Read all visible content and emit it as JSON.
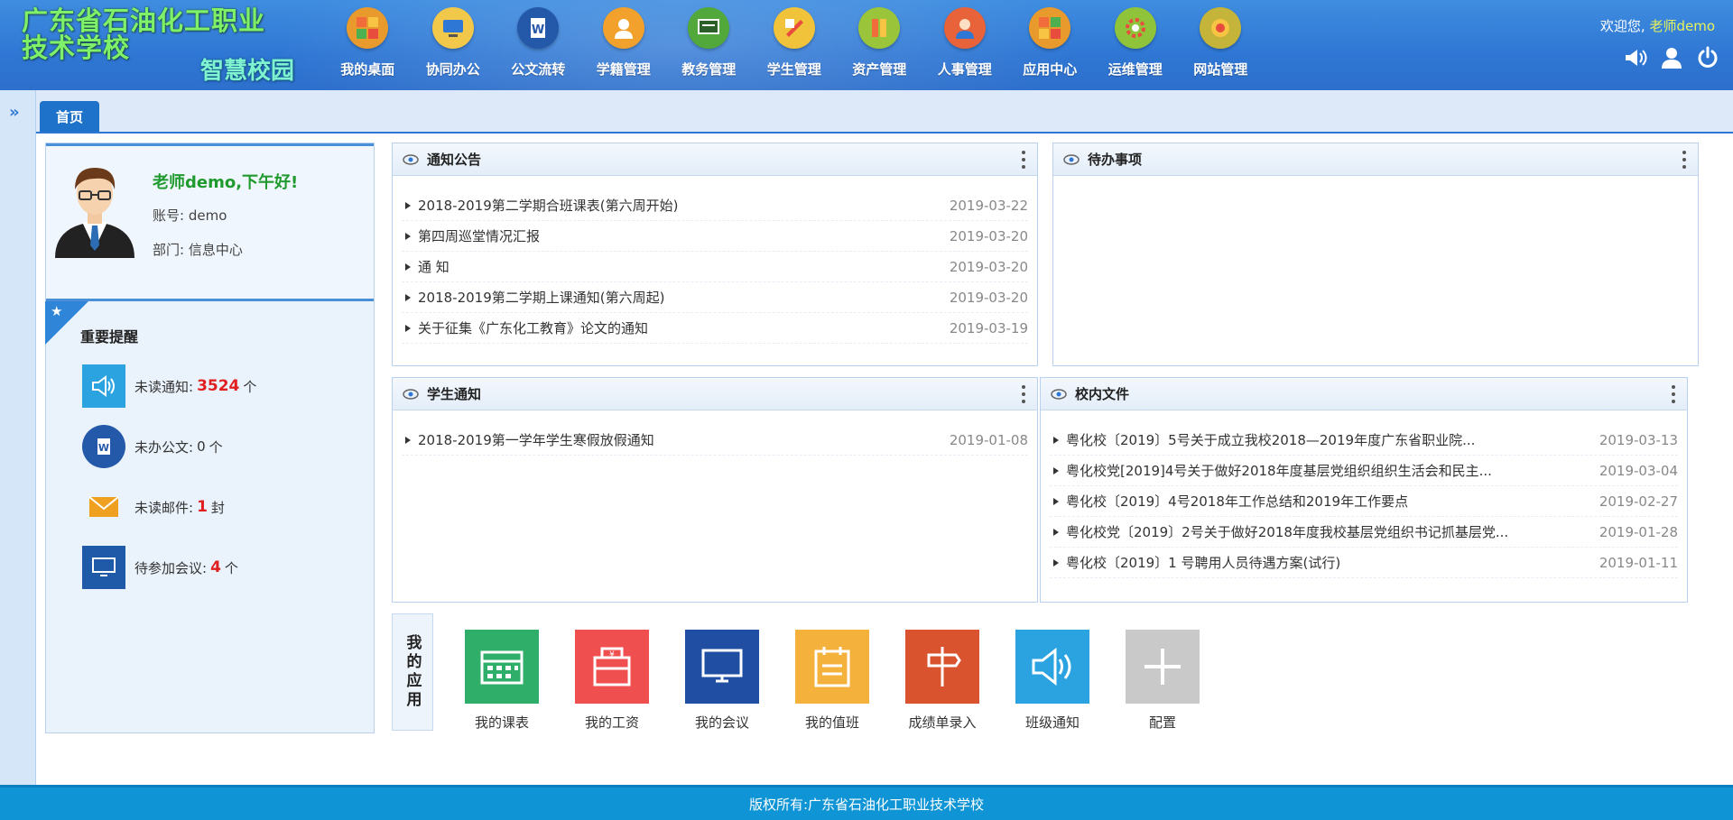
{
  "header": {
    "school_name": "广东省石油化工职业技术学校",
    "school_line1": "广东省石油化工职业",
    "school_line2": "技术学校",
    "subtitle": "智慧校园",
    "welcome_prefix": "欢迎您,",
    "username": "老师demo"
  },
  "nav": [
    {
      "label": "我的桌面",
      "icon": "desktop-icon",
      "color": "#e89a2c"
    },
    {
      "label": "协同办公",
      "icon": "office-icon",
      "color": "#f2c84b"
    },
    {
      "label": "公文流转",
      "icon": "document-icon",
      "color": "#2458a8"
    },
    {
      "label": "学籍管理",
      "icon": "student-record-icon",
      "color": "#f2a12c"
    },
    {
      "label": "教务管理",
      "icon": "teaching-icon",
      "color": "#52a83a"
    },
    {
      "label": "学生管理",
      "icon": "student-icon",
      "color": "#f0c33a"
    },
    {
      "label": "资产管理",
      "icon": "asset-icon",
      "color": "#9ac43a"
    },
    {
      "label": "人事管理",
      "icon": "personnel-icon",
      "color": "#e8623a"
    },
    {
      "label": "应用中心",
      "icon": "apps-icon",
      "color": "#e89a2c"
    },
    {
      "label": "运维管理",
      "icon": "maintenance-icon",
      "color": "#8fc43a"
    },
    {
      "label": "网站管理",
      "icon": "website-icon",
      "color": "#c4b43a"
    }
  ],
  "tabs": [
    {
      "label": "首页"
    }
  ],
  "profile": {
    "greeting": "老师demo,下午好!",
    "account_label": "账号:",
    "account": "demo",
    "dept_label": "部门:",
    "dept": "信息中心"
  },
  "reminders": {
    "title": "重要提醒",
    "items": [
      {
        "label": "未读通知:",
        "count": "3524",
        "unit": "个",
        "highlight": true,
        "icon": "speaker-icon",
        "color": "#2aa3e0"
      },
      {
        "label": "未办公文:",
        "count": "0",
        "unit": "个",
        "highlight": false,
        "icon": "document-icon",
        "color": "#2458a8"
      },
      {
        "label": "未读邮件:",
        "count": "1",
        "unit": "封",
        "highlight": true,
        "icon": "mail-icon",
        "color": "#f0a020"
      },
      {
        "label": "待参加会议:",
        "count": "4",
        "unit": "个",
        "highlight": true,
        "icon": "monitor-icon",
        "color": "#1f5aa8"
      }
    ]
  },
  "panels": {
    "notices": {
      "title": "通知公告",
      "items": [
        {
          "title": "2018-2019第二学期合班课表(第六周开始)",
          "date": "2019-03-22"
        },
        {
          "title": "第四周巡堂情况汇报",
          "date": "2019-03-20"
        },
        {
          "title": "通 知",
          "date": "2019-03-20"
        },
        {
          "title": "2018-2019第二学期上课通知(第六周起)",
          "date": "2019-03-20"
        },
        {
          "title": "关于征集《广东化工教育》论文的通知",
          "date": "2019-03-19"
        }
      ]
    },
    "todo": {
      "title": "待办事项",
      "items": []
    },
    "student_notices": {
      "title": "学生通知",
      "items": [
        {
          "title": "2018-2019第一学年学生寒假放假通知",
          "date": "2019-01-08"
        }
      ]
    },
    "school_docs": {
      "title": "校内文件",
      "items": [
        {
          "title": "粤化校〔2019〕5号关于成立我校2018—2019年度广东省职业院...",
          "date": "2019-03-13"
        },
        {
          "title": "粤化校党[2019]4号关于做好2018年度基层党组织组织生活会和民主...",
          "date": "2019-03-04"
        },
        {
          "title": "粤化校〔2019〕4号2018年工作总结和2019年工作要点",
          "date": "2019-02-27"
        },
        {
          "title": "粤化校党〔2019〕2号关于做好2018年度我校基层党组织书记抓基层党...",
          "date": "2019-01-28"
        },
        {
          "title": "粤化校〔2019〕1 号聘用人员待遇方案(试行)",
          "date": "2019-01-11"
        }
      ]
    }
  },
  "apps": {
    "label": "我的应用",
    "items": [
      {
        "label": "我的课表",
        "icon": "calendar-icon",
        "color": "#2fae6a"
      },
      {
        "label": "我的工资",
        "icon": "wallet-icon",
        "color": "#ef4f4f"
      },
      {
        "label": "我的会议",
        "icon": "monitor-icon",
        "color": "#1f4ea3"
      },
      {
        "label": "我的值班",
        "icon": "clipboard-icon",
        "color": "#f4b13c"
      },
      {
        "label": "成绩单录入",
        "icon": "signpost-icon",
        "color": "#d9532f"
      },
      {
        "label": "班级通知",
        "icon": "speaker-icon",
        "color": "#2aa3e0"
      },
      {
        "label": "配置",
        "icon": "plus-icon",
        "color": "#c9c9c9"
      }
    ]
  },
  "footer": {
    "text": "版权所有:广东省石油化工职业技术学校"
  }
}
